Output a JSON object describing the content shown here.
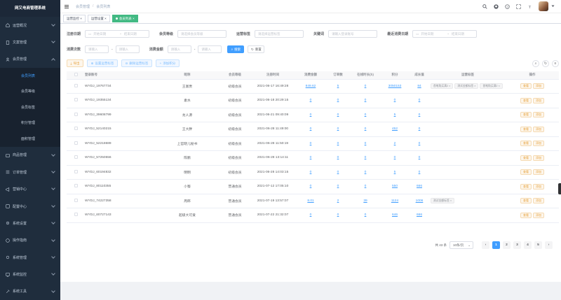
{
  "sidebar": {
    "title": "网又电商管理系统",
    "items": [
      {
        "label": "运营概况",
        "icon": "home-icon",
        "expanded": false
      },
      {
        "label": "文案管理",
        "icon": "document-icon",
        "expanded": false
      },
      {
        "label": "会员管理",
        "icon": "user-icon",
        "expanded": true,
        "children": [
          {
            "label": "会员列表",
            "active": true
          },
          {
            "label": "会员等级",
            "active": false
          },
          {
            "label": "会员标签",
            "active": false
          },
          {
            "label": "积分管理",
            "active": false
          },
          {
            "label": "面积管理",
            "active": false
          }
        ]
      },
      {
        "label": "商品管理",
        "icon": "goods-icon",
        "expanded": false
      },
      {
        "label": "订单管理",
        "icon": "order-icon",
        "expanded": false
      },
      {
        "label": "营销中心",
        "icon": "marketing-icon",
        "expanded": false
      },
      {
        "label": "配置中心",
        "icon": "config-icon",
        "expanded": false
      },
      {
        "label": "系统设置",
        "icon": "gear-icon",
        "expanded": false
      },
      {
        "label": "操作指南",
        "icon": "guide-icon",
        "expanded": false
      },
      {
        "label": "系统管理",
        "icon": "settings-icon",
        "expanded": false
      },
      {
        "label": "系统监控",
        "icon": "monitor-icon",
        "expanded": false
      },
      {
        "label": "系统工具",
        "icon": "tool-icon",
        "expanded": false
      }
    ]
  },
  "breadcrumb": [
    "会员管理",
    "会员列表"
  ],
  "tags": [
    "运营监控",
    "运营设置",
    "会员列表"
  ],
  "filters": {
    "register_date_label": "注册日期",
    "start_placeholder": "开始日期",
    "end_placeholder": "结束日期",
    "level_label": "会员等级",
    "level_placeholder": "请选择会员等级",
    "ops_tag_label": "运营标签",
    "ops_tag_placeholder": "请选择运营标签",
    "keyword_label": "关键词",
    "keyword_placeholder": "请输入登录账号",
    "last_consume_label": "最近消费日期",
    "consume_count_label": "消费次数",
    "consume_amount_label": "消费金额",
    "range_placeholder": "请输入",
    "search_label": "搜索",
    "reset_label": "重置"
  },
  "toolbar": {
    "export_label": "导出",
    "set_tag_label": "设置运营标签",
    "del_tag_label": "删除运营标签",
    "add_points_label": "添加积分"
  },
  "table": {
    "columns": [
      "登录账号",
      "昵称",
      "会员等级",
      "注册时间",
      "消费金额",
      "订单数",
      "在线时长(h)",
      "积分",
      "成长值",
      "运营标签",
      "操作"
    ],
    "rows": [
      {
        "account": "WYDJ_19767734",
        "nick": "王富贵",
        "level": "初级会员",
        "time": "2021-06-17 16:49:28",
        "amount": "849.62",
        "orders": "5",
        "online": "0",
        "points": "3050153",
        "growth": "84",
        "tags": [
          "首笔购买满2",
          "测试金额标签",
          "首笔购买满2"
        ]
      },
      {
        "account": "WYDJ_19355134",
        "nick": "素水",
        "level": "初级会员",
        "time": "2021-06-18 20:29:15",
        "amount": "0",
        "orders": "0",
        "online": "0",
        "points": "0",
        "growth": "0",
        "tags": []
      },
      {
        "account": "WYDJ_39608799",
        "nick": "龙人源",
        "level": "初级会员",
        "time": "2021-06-21 09:40:09",
        "amount": "0",
        "orders": "0",
        "online": "0",
        "points": "5",
        "growth": "0",
        "tags": []
      },
      {
        "account": "WYDJ_52140215",
        "nick": "王大胖",
        "level": "初级会员",
        "time": "2021-06-28 11:49:00",
        "amount": "0",
        "orders": "0",
        "online": "0",
        "points": "452",
        "growth": "0",
        "tags": []
      },
      {
        "account": "WYDJ_52218689",
        "nick": "上官晓儿秘书",
        "level": "初级会员",
        "time": "2021-06-28 11:50:19",
        "amount": "0",
        "orders": "0",
        "online": "0",
        "points": "2",
        "growth": "0",
        "tags": []
      },
      {
        "account": "WYDJ_57250556",
        "nick": "陈鹏",
        "level": "初级会员",
        "time": "2021-06-28 13:14:11",
        "amount": "0",
        "orders": "0",
        "online": "0",
        "points": "0",
        "growth": "0",
        "tags": []
      },
      {
        "account": "WYDJ_60194832",
        "nick": "明明",
        "level": "初级会员",
        "time": "2021-06-28 14:03:15",
        "amount": "0",
        "orders": "0",
        "online": "0",
        "points": "5",
        "growth": "0",
        "tags": []
      },
      {
        "account": "WYDJ_80110355",
        "nick": "小蜀",
        "level": "普通会员",
        "time": "2021-07-12 17:05:10",
        "amount": "0",
        "orders": "0",
        "online": "0",
        "points": "550",
        "growth": "666",
        "tags": []
      },
      {
        "account": "WYDJ_74227358",
        "nick": "周郎",
        "level": "普通会员",
        "time": "2021-07-19 13:57:07",
        "amount": "8.01",
        "orders": "2",
        "online": "39",
        "points": "1124",
        "growth": "1006",
        "tags": [
          "测试金额标签"
        ]
      },
      {
        "account": "WYDJ_60727143",
        "nick": "超级大可爱",
        "level": "普通会员",
        "time": "2021-07-22 21:32:07",
        "amount": "0",
        "orders": "0",
        "online": "0",
        "points": "646",
        "growth": "666",
        "tags": []
      }
    ],
    "op_view": "查看",
    "op_add": "添加"
  },
  "pagination": {
    "total_label": "共 43 条",
    "page_size": "10条/页",
    "pages": [
      "1",
      "2",
      "3",
      "4",
      "5"
    ],
    "current": "1"
  },
  "colors": {
    "sidebar_bg": "#1f2d3d",
    "accent": "#409eff",
    "active_tag": "#42b983",
    "warning": "#e6a23c"
  }
}
